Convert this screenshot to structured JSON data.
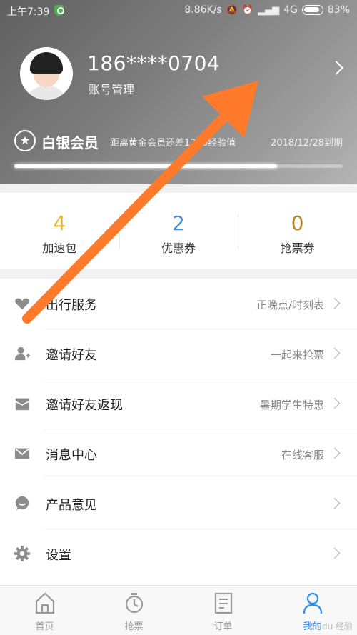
{
  "statusbar": {
    "time": "上午7:39",
    "net_speed": "8.86K/s",
    "network": "4G",
    "battery": "83%"
  },
  "profile": {
    "phone": "186****0704",
    "account_label": "账号管理"
  },
  "membership": {
    "level": "白银会员",
    "progress_text": "距离黄金会员还差1230经验值",
    "expire": "2018/12/28到期",
    "progress_fraction": 0.8
  },
  "stats": [
    {
      "value": "4",
      "label": "加速包",
      "color": "#f0b429"
    },
    {
      "value": "2",
      "label": "优惠券",
      "color": "#4a90d9"
    },
    {
      "value": "0",
      "label": "抢票券",
      "color": "#b8892a"
    }
  ],
  "menu": [
    {
      "label": "出行服务",
      "hint": "正晚点/时刻表",
      "icon": "heart-icon"
    },
    {
      "label": "邀请好友",
      "hint": "一起来抢票",
      "icon": "user-add-icon"
    },
    {
      "label": "邀请好友返现",
      "hint": "暑期学生特惠",
      "icon": "envelope-open-icon"
    },
    {
      "label": "消息中心",
      "hint": "在线客服",
      "icon": "mail-icon"
    },
    {
      "label": "产品意见",
      "hint": "",
      "icon": "chat-bubble-icon"
    },
    {
      "label": "设置",
      "hint": "",
      "icon": "gear-icon"
    }
  ],
  "tabs": [
    {
      "label": "首页",
      "icon": "home-icon"
    },
    {
      "label": "抢票",
      "icon": "stopwatch-icon"
    },
    {
      "label": "订单",
      "icon": "document-icon"
    },
    {
      "label": "我的",
      "icon": "person-icon"
    }
  ],
  "watermark": "Baidu 经验",
  "colors": {
    "accent": "#2d8cf0",
    "annotation_arrow": "#ff7a2a"
  }
}
